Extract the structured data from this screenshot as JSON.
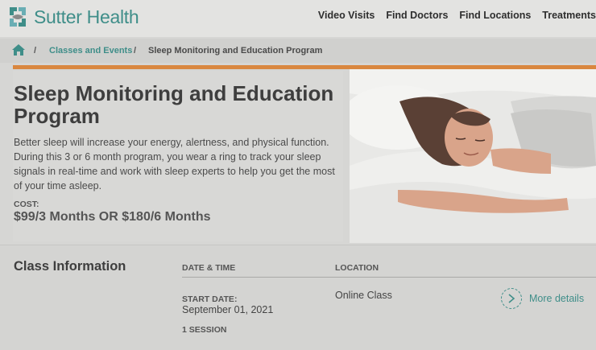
{
  "header": {
    "brand": "Sutter Health",
    "nav": [
      "Video Visits",
      "Find Doctors",
      "Find Locations",
      "Treatments"
    ]
  },
  "breadcrumb": {
    "home_icon": "home-icon",
    "separator": "/",
    "items": [
      "Classes and Events",
      "Sleep Monitoring and Education Program"
    ]
  },
  "hero": {
    "title": "Sleep Monitoring and Education Program",
    "description": "Better sleep will increase your energy, alertness, and physical function. During this 3 or 6 month program, you wear a ring to track your sleep signals in real-time and work with sleep experts to help you get the most of your time asleep.",
    "cost_label": "COST:",
    "cost_value": "$99/3 Months OR $180/6 Months"
  },
  "class_info": {
    "title": "Class Information",
    "col_date": "DATE & TIME",
    "col_location": "LOCATION",
    "start_label": "START DATE:",
    "start_date": "September 01, 2021",
    "sessions": "1 SESSION",
    "location": "Online Class",
    "more_details": "More details"
  },
  "colors": {
    "brand_teal": "#3f8e89",
    "accent_orange": "#d9873f",
    "text_dark": "#3e3e3e"
  }
}
